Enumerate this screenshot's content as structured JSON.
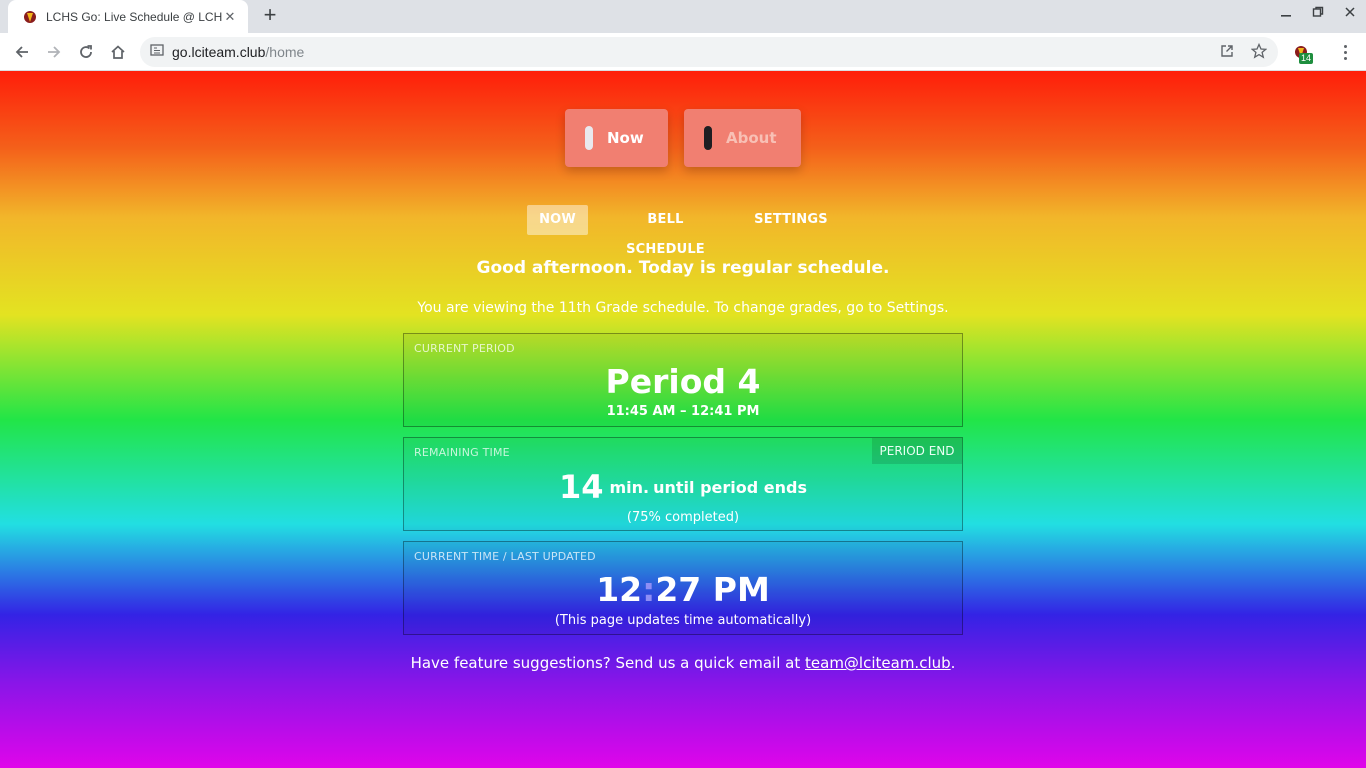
{
  "browser": {
    "tab_title": "LCHS Go: Live Schedule @ LCHS",
    "url_host": "go.lciteam.club",
    "url_path": "/home",
    "extension_badge": "14"
  },
  "top_buttons": {
    "now_label": "Now",
    "about_label": "About"
  },
  "subnav": {
    "items": [
      "NOW",
      "BELL SCHEDULE",
      "SETTINGS"
    ]
  },
  "greeting": "Good afternoon. Today is regular schedule.",
  "viewing": "You are viewing the 11th Grade schedule. To change grades, go to Settings.",
  "current_period": {
    "label": "CURRENT PERIOD",
    "name": "Period 4",
    "range": "11:45 AM – 12:41 PM"
  },
  "remaining": {
    "label": "REMAINING TIME",
    "badge": "PERIOD END",
    "minutes": "14",
    "unit": "min.",
    "text": "until period ends",
    "percent_text": "(75% completed)",
    "percent": 75
  },
  "clock": {
    "label": "CURRENT TIME / LAST UPDATED",
    "hours": "12",
    "colon": ":",
    "minutes_suffix": "27 PM",
    "note": "(This page updates time automatically)"
  },
  "footer": {
    "text": "Have feature suggestions? Send us a quick email at ",
    "email": "team@lciteam.club",
    "end": "."
  },
  "colors": {
    "gradient_top": "#ff1e0a",
    "gradient_bottom": "#e005ea",
    "button_bg": "#f17f71"
  }
}
